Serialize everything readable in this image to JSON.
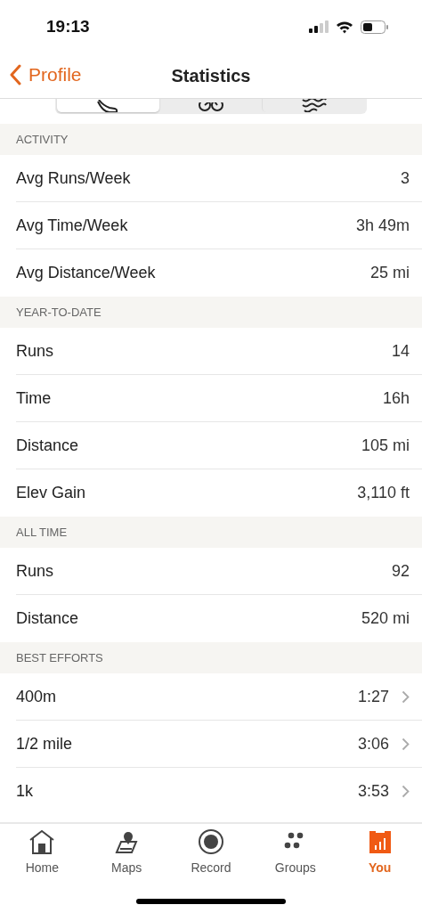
{
  "status_bar": {
    "time": "19:13"
  },
  "nav": {
    "back": "Profile",
    "title": "Statistics"
  },
  "sport_tabs": [
    {
      "selected": true
    },
    {
      "selected": false
    },
    {
      "selected": false
    }
  ],
  "sections": [
    {
      "title": "ACTIVITY",
      "rows": [
        {
          "kind": "stat",
          "label": "Avg Runs/Week",
          "value": "3"
        },
        {
          "kind": "stat",
          "label": "Avg Time/Week",
          "value": "3h 49m"
        },
        {
          "kind": "stat",
          "label": "Avg Distance/Week",
          "value": "25 mi"
        }
      ]
    },
    {
      "title": "YEAR-TO-DATE",
      "rows": [
        {
          "kind": "stat",
          "label": "Runs",
          "value": "14"
        },
        {
          "kind": "stat",
          "label": "Time",
          "value": "16h"
        },
        {
          "kind": "stat",
          "label": "Distance",
          "value": "105 mi"
        },
        {
          "kind": "stat",
          "label": "Elev Gain",
          "value": "3,110 ft"
        }
      ]
    },
    {
      "title": "ALL TIME",
      "rows": [
        {
          "kind": "stat",
          "label": "Runs",
          "value": "92"
        },
        {
          "kind": "stat",
          "label": "Distance",
          "value": "520 mi"
        }
      ]
    },
    {
      "title": "BEST EFFORTS",
      "rows": [
        {
          "kind": "link",
          "label": "400m",
          "value": "1:27"
        },
        {
          "kind": "link",
          "label": "1/2 mile",
          "value": "3:06"
        },
        {
          "kind": "link",
          "label": "1k",
          "value": "3:53"
        }
      ]
    }
  ],
  "tab_bar": [
    {
      "label": "Home",
      "selected": false
    },
    {
      "label": "Maps",
      "selected": false
    },
    {
      "label": "Record",
      "selected": false
    },
    {
      "label": "Groups",
      "selected": false
    },
    {
      "label": "You",
      "selected": true
    }
  ]
}
